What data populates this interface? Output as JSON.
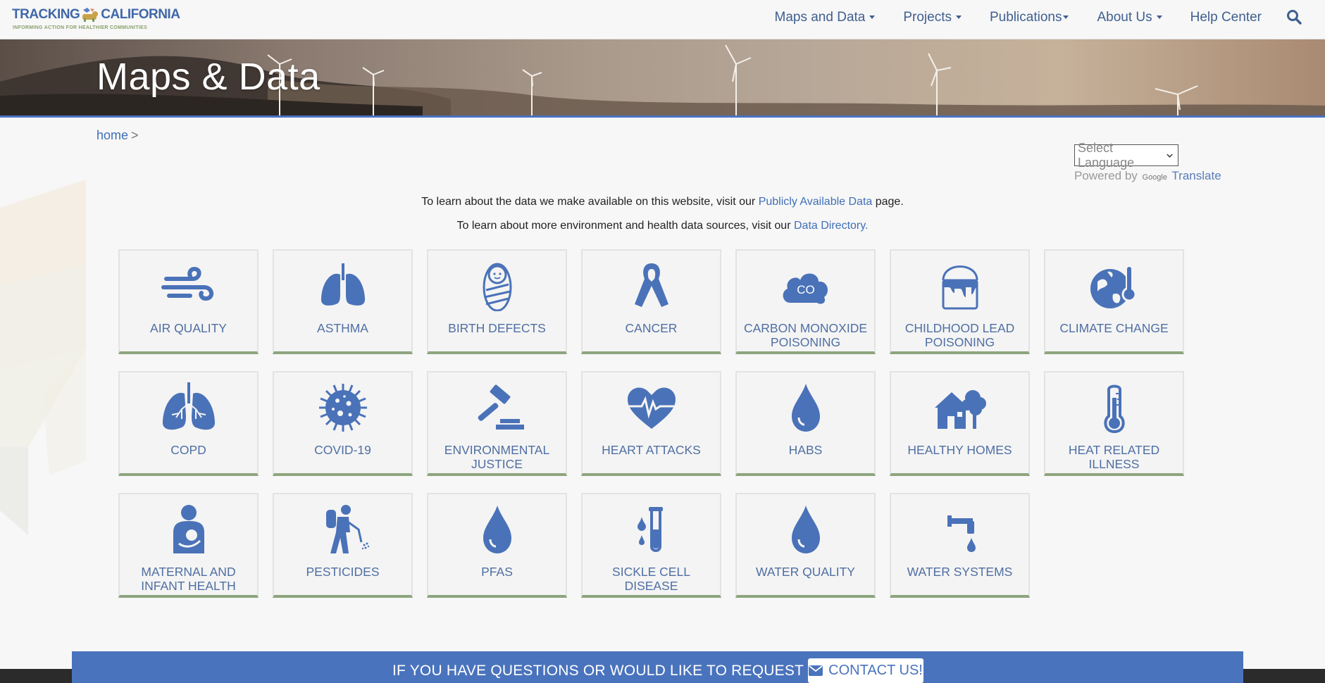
{
  "brand": {
    "name_left": "TRACKING",
    "name_right": "CALIFORNIA",
    "tagline": "INFORMING ACTION FOR HEALTHIER COMMUNITIES"
  },
  "nav": {
    "items": [
      {
        "label": "Maps and Data",
        "dropdown": true
      },
      {
        "label": "Projects",
        "dropdown": true
      },
      {
        "label": "Publications",
        "dropdown": true
      },
      {
        "label": "About Us",
        "dropdown": true
      },
      {
        "label": "Help Center",
        "dropdown": false
      }
    ],
    "search_icon": "search-icon"
  },
  "hero": {
    "title": "Maps & Data"
  },
  "breadcrumb": {
    "home": "home",
    "separator": ">"
  },
  "translate": {
    "select_value": "Select Language",
    "powered_by": "Powered by",
    "google": "Google",
    "translate": "Translate"
  },
  "intro": {
    "line1_before": "To learn about the data we make available on this website, visit our",
    "line1_link": "Publicly Available Data",
    "line1_after": "page.",
    "line2_before": "To learn about more environment and health data sources, visit our",
    "line2_link": "Data Directory."
  },
  "tiles": [
    {
      "label": "AIR QUALITY",
      "icon": "wind-icon"
    },
    {
      "label": "ASTHMA",
      "icon": "lungs-icon"
    },
    {
      "label": "BIRTH DEFECTS",
      "icon": "swaddled-baby-icon"
    },
    {
      "label": "CANCER",
      "icon": "ribbon-icon"
    },
    {
      "label": "CARBON MONOXIDE POISONING",
      "icon": "co-cloud-icon"
    },
    {
      "label": "CHILDHOOD LEAD POISONING",
      "icon": "paint-bucket-icon"
    },
    {
      "label": "CLIMATE CHANGE",
      "icon": "globe-thermometer-icon"
    },
    {
      "label": "COPD",
      "icon": "bronchi-lungs-icon"
    },
    {
      "label": "COVID-19",
      "icon": "virus-icon"
    },
    {
      "label": "ENVIRONMENTAL JUSTICE",
      "icon": "gavel-icon"
    },
    {
      "label": "HEART ATTACKS",
      "icon": "heartbeat-icon"
    },
    {
      "label": "HABS",
      "icon": "droplet-icon"
    },
    {
      "label": "HEALTHY HOMES",
      "icon": "house-tree-icon"
    },
    {
      "label": "HEAT RELATED ILLNESS",
      "icon": "thermometer-icon"
    },
    {
      "label": "MATERNAL AND INFANT HEALTH",
      "icon": "mother-baby-icon"
    },
    {
      "label": "PESTICIDES",
      "icon": "sprayer-person-icon"
    },
    {
      "label": "PFAS",
      "icon": "droplet-icon"
    },
    {
      "label": "SICKLE CELL DISEASE",
      "icon": "test-tube-icon"
    },
    {
      "label": "WATER QUALITY",
      "icon": "droplet-icon"
    },
    {
      "label": "WATER SYSTEMS",
      "icon": "faucet-icon"
    }
  ],
  "cta": {
    "text": "IF YOU HAVE QUESTIONS OR WOULD LIKE TO REQUEST DATA",
    "button": "CONTACT US!"
  },
  "colors": {
    "accent": "#4a73bd",
    "icon": "#4a72b8",
    "tile_border_bottom": "#8da57e",
    "link": "#3f6fb6"
  }
}
